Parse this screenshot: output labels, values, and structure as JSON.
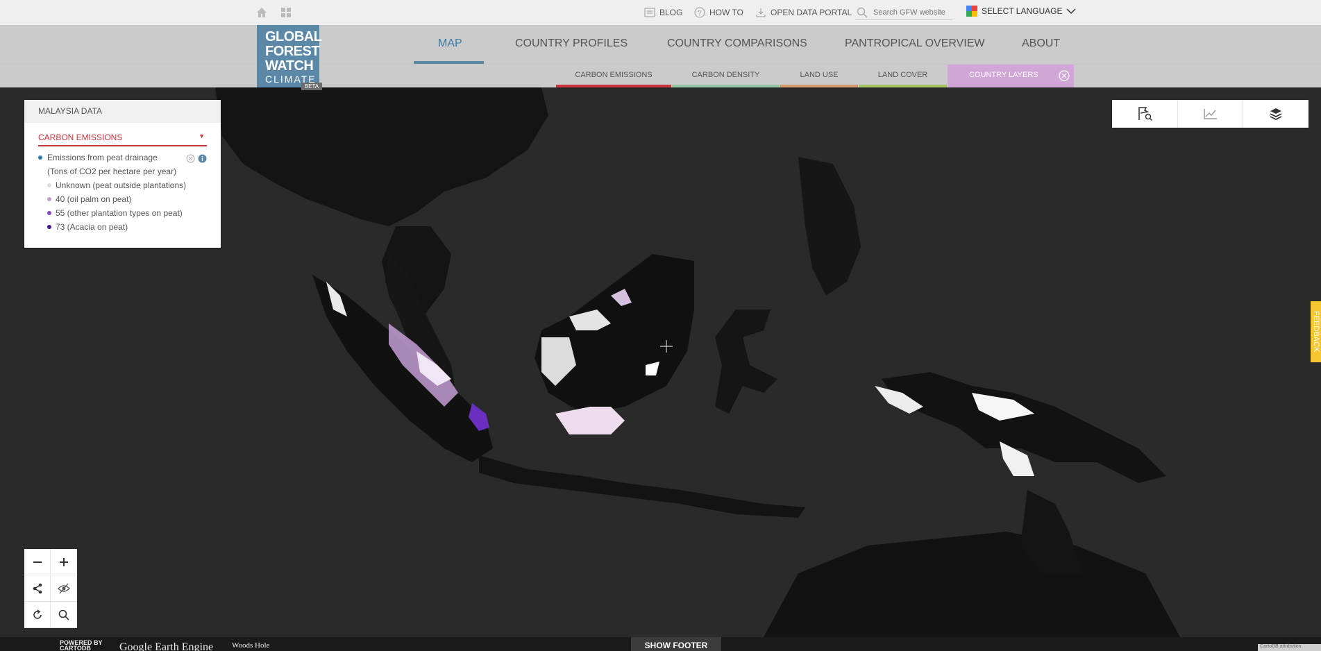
{
  "topbar": {
    "icons": [
      "home-icon",
      "apps-grid-icon"
    ],
    "blog": "BLOG",
    "how_to": "HOW TO",
    "open_data_portal": "OPEN DATA PORTAL",
    "search_placeholder": "Search GFW website",
    "select_language": "SELECT LANGUAGE"
  },
  "logo": {
    "line1": "GLOBAL",
    "line2": "FOREST",
    "line3": "WATCH",
    "line4": "CLIMATE",
    "badge": "BETA"
  },
  "nav": {
    "items": [
      "MAP",
      "COUNTRY PROFILES",
      "COUNTRY COMPARISONS",
      "PANTROPICAL OVERVIEW",
      "ABOUT"
    ],
    "active": "MAP",
    "active_color": "#5c88a8"
  },
  "layer_tabs": [
    {
      "label": "CARBON EMISSIONS",
      "color": "#c8343a"
    },
    {
      "label": "CARBON DENSITY",
      "color": "#8ec9a4"
    },
    {
      "label": "LAND USE",
      "color": "#d39a6b"
    },
    {
      "label": "LAND COVER",
      "color": "#a5c45c"
    },
    {
      "label": "COUNTRY LAYERS",
      "color": "#cfa6d6",
      "active": true
    }
  ],
  "legend": {
    "header": "MALAYSIA DATA",
    "category": "CARBON EMISSIONS",
    "layer_name": "Emissions from peat drainage",
    "unit": "(Tons of CO2 per hectare per year)",
    "classes": [
      {
        "label": "Unknown (peat outside plantations)",
        "color": "#dddddd"
      },
      {
        "label": "40 (oil palm on peat)",
        "color": "#c49ed6"
      },
      {
        "label": "55 (other plantation types on peat)",
        "color": "#8b4bc4"
      },
      {
        "label": "73 (Acacia on peat)",
        "color": "#4a1696"
      }
    ],
    "layer_dot_color": "#2a7ab0"
  },
  "tools": [
    "country-search-icon",
    "chart-icon",
    "layers-icon"
  ],
  "feedback": "FEEDBACK",
  "zoom_controls": [
    "zoom-out-icon",
    "zoom-in-icon",
    "share-icon",
    "hide-icon",
    "reset-icon",
    "search-icon"
  ],
  "footer": {
    "show_footer": "SHOW FOOTER",
    "credits": {
      "carto_powered": "POWERED BY",
      "carto": "CARTODB",
      "google": "Google Earth Engine",
      "woods_hole": "Woods Hole"
    },
    "corner": "CartoDB attribution"
  }
}
